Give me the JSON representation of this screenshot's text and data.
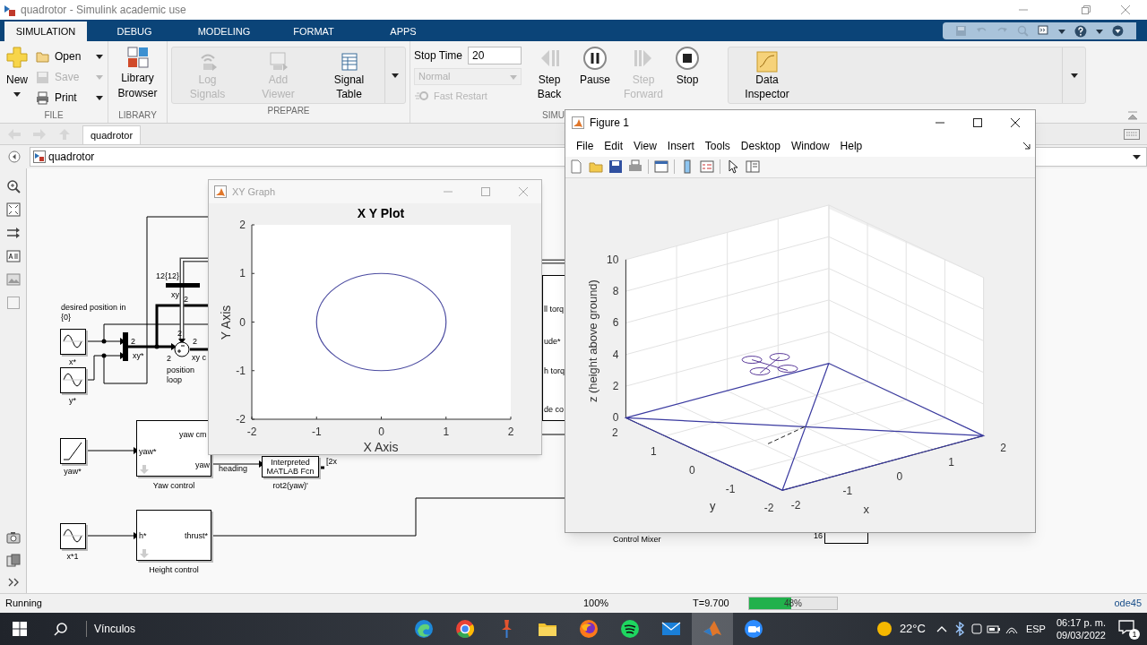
{
  "window": {
    "title": "quadrotor - Simulink academic use"
  },
  "tabs": [
    {
      "label": "SIMULATION",
      "selected": true
    },
    {
      "label": "DEBUG",
      "selected": false
    },
    {
      "label": "MODELING",
      "selected": false
    },
    {
      "label": "FORMAT",
      "selected": false
    },
    {
      "label": "APPS",
      "selected": false
    }
  ],
  "ribbon": {
    "file": {
      "label": "FILE",
      "new": "New",
      "items": [
        {
          "kind": "open",
          "label": "Open",
          "disabled": false
        },
        {
          "kind": "save",
          "label": "Save",
          "disabled": true
        },
        {
          "kind": "print",
          "label": "Print",
          "disabled": false
        }
      ]
    },
    "library": {
      "label": "LIBRARY",
      "button": "Library Browser"
    },
    "prepare": {
      "label": "PREPARE",
      "buttons": [
        {
          "kind": "log",
          "label": "Log Signals",
          "disabled": true
        },
        {
          "kind": "viewer",
          "label": "Add Viewer",
          "disabled": true
        },
        {
          "kind": "table",
          "label": "Signal Table",
          "disabled": false
        }
      ]
    },
    "simulate": {
      "label": "SIMU",
      "stop_time_label": "Stop Time",
      "stop_time": "20",
      "mode": "Normal",
      "mode_disabled": true,
      "fast_restart": "Fast Restart",
      "fast_restart_disabled": true,
      "buttons": [
        {
          "kind": "step_back",
          "label": "Step Back",
          "disabled": false
        },
        {
          "kind": "pause",
          "label": "Pause",
          "disabled": false
        },
        {
          "kind": "step_forward",
          "label": "Step Forward",
          "disabled": true
        },
        {
          "kind": "stop",
          "label": "Stop",
          "disabled": false
        }
      ]
    },
    "review": {
      "button": "Data Inspector"
    }
  },
  "breadcrumb": {
    "tab": "quadrotor"
  },
  "address": {
    "path": "quadrotor"
  },
  "diagram": {
    "blocks": [
      {
        "kind": "sine",
        "caption": "x*"
      },
      {
        "kind": "sine",
        "caption": "y*"
      },
      {
        "kind": "ramp",
        "caption": "yaw*"
      },
      {
        "kind": "sine",
        "caption": "x*1"
      },
      {
        "kind": "subsystem",
        "caption": "Yaw control",
        "ports": [
          "yaw*",
          "yaw cm",
          "yaw"
        ]
      },
      {
        "kind": "subsystem",
        "caption": "Height control",
        "ports": [
          "h*",
          "thrust*"
        ]
      },
      {
        "kind": "fcn",
        "caption": "rot2(yaw)'",
        "text": "Interpreted MATLAB Fcn"
      }
    ],
    "labels": [
      "desired position in {0}",
      "12{12}",
      "xy",
      "2",
      "2",
      "xy*",
      "2",
      "2",
      "2",
      "xy c",
      "position loop",
      "heading",
      "[2x",
      "ll torq",
      "ude*",
      "h torq",
      "de co",
      "Control Mixer",
      "16"
    ]
  },
  "xy_graph": {
    "title": "XY Graph",
    "chart_data": {
      "type": "line",
      "title": "X Y Plot",
      "xlabel": "X Axis",
      "ylabel": "Y Axis",
      "xlim": [
        -2,
        2
      ],
      "ylim": [
        -2,
        2
      ],
      "xticks": [
        -2,
        -1,
        0,
        1,
        2
      ],
      "yticks": [
        -2,
        -1,
        0,
        1,
        2
      ]
    }
  },
  "figure": {
    "title": "Figure 1",
    "menu": [
      "File",
      "Edit",
      "View",
      "Insert",
      "Tools",
      "Desktop",
      "Window",
      "Help"
    ],
    "plot": {
      "zlabel": "z (height above ground)",
      "xlabel": "x",
      "ylabel": "y",
      "zticks": [
        "10",
        "8",
        "6",
        "4",
        "2",
        "0"
      ],
      "yticks": [
        "2",
        "1",
        "0",
        "-1",
        "-2"
      ],
      "xticks": [
        "-2",
        "-1",
        "0",
        "1",
        "2"
      ]
    }
  },
  "status_bar": {
    "state": "Running",
    "zoom": "100%",
    "time": "T=9.700",
    "progress": {
      "level": 0.48,
      "text": "48%"
    },
    "solver": "ode45"
  },
  "taskbar": {
    "search_text": "Vínculos",
    "apps": [
      {
        "kind": "edge",
        "selected": false
      },
      {
        "kind": "chrome",
        "selected": false
      },
      {
        "kind": "pin",
        "selected": false
      },
      {
        "kind": "folder",
        "selected": false
      },
      {
        "kind": "firefox",
        "selected": false
      },
      {
        "kind": "spotify",
        "selected": false
      },
      {
        "kind": "mail",
        "selected": false
      },
      {
        "kind": "matlab",
        "selected": true
      },
      {
        "kind": "zoom",
        "selected": false
      }
    ],
    "temperature": "22°C",
    "language": "ESP",
    "time": "06:17 p. m.",
    "date": "09/03/2022",
    "notifications": "1"
  }
}
